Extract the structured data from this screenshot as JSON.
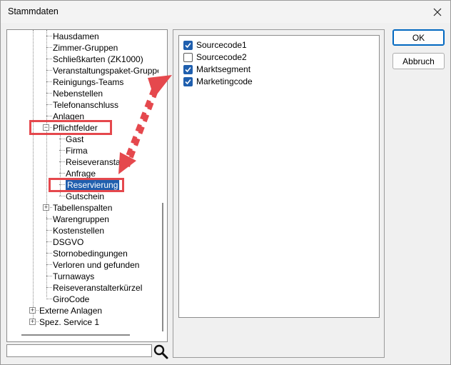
{
  "window": {
    "title": "Stammdaten"
  },
  "tree": {
    "items": [
      {
        "label": "Hausdamen"
      },
      {
        "label": "Zimmer-Gruppen"
      },
      {
        "label": "Schließkarten (ZK1000)"
      },
      {
        "label": "Veranstaltungspaket-Gruppen"
      },
      {
        "label": "Reinigungs-Teams"
      },
      {
        "label": "Nebenstellen"
      },
      {
        "label": "Telefonanschluss"
      },
      {
        "label": "Anlagen"
      },
      {
        "label": "Pflichtfelder",
        "expander": "−"
      },
      {
        "label": "Gast"
      },
      {
        "label": "Firma"
      },
      {
        "label": "Reiseveranstalt"
      },
      {
        "label": "Anfrage"
      },
      {
        "label": "Reservierung",
        "selected": true
      },
      {
        "label": "Gutschein"
      },
      {
        "label": "Tabellenspalten",
        "expander": "+"
      },
      {
        "label": "Warengruppen"
      },
      {
        "label": "Kostenstellen"
      },
      {
        "label": "DSGVO"
      },
      {
        "label": "Stornobedingungen"
      },
      {
        "label": "Verloren und gefunden"
      },
      {
        "label": "Turnaways"
      },
      {
        "label": "Reiseveranstalterkürzel"
      },
      {
        "label": "GiroCode"
      },
      {
        "label": "Externe Anlagen",
        "expander": "+"
      },
      {
        "label": "Spez. Service 1",
        "expander": "+"
      }
    ]
  },
  "search": {
    "value": "",
    "placeholder": ""
  },
  "checklist": {
    "items": [
      {
        "label": "Sourcecode1",
        "checked": true
      },
      {
        "label": "Sourcecode2",
        "checked": false
      },
      {
        "label": "Marktsegment",
        "checked": true
      },
      {
        "label": "Marketingcode",
        "checked": true
      }
    ]
  },
  "buttons": {
    "ok": "OK",
    "cancel": "Abbruch"
  },
  "colors": {
    "highlight": "#e5484d",
    "selection": "#1f5fae",
    "arrow": "#e5484d"
  }
}
